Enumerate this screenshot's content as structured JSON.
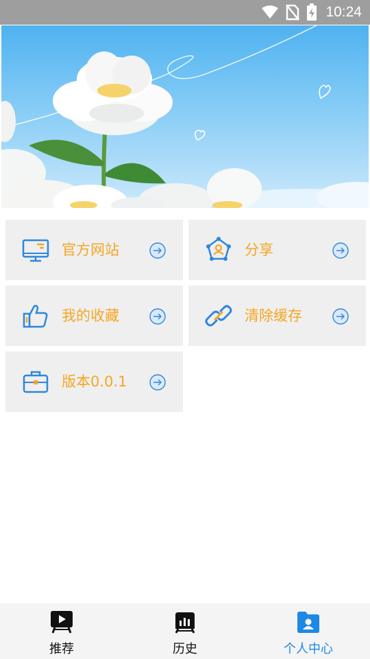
{
  "status_bar": {
    "time": "10:24",
    "icons": [
      "wifi-icon",
      "no-sim-icon",
      "battery-charging-icon"
    ]
  },
  "banner": {
    "description_icon": "flower-banner-image"
  },
  "menu": {
    "items": [
      {
        "label": "官方网站",
        "icon": "monitor-icon"
      },
      {
        "label": "分享",
        "icon": "share-network-icon"
      },
      {
        "label": "我的收藏",
        "icon": "thumbs-up-icon"
      },
      {
        "label": "清除缓存",
        "icon": "link-icon"
      },
      {
        "label": "版本0.0.1",
        "icon": "briefcase-icon"
      }
    ],
    "arrow_icon": "arrow-right-circle-icon"
  },
  "tabbar": {
    "tabs": [
      {
        "label": "推荐",
        "icon": "video-play-icon",
        "active": false
      },
      {
        "label": "历史",
        "icon": "history-icon",
        "active": false
      },
      {
        "label": "个人中心",
        "icon": "user-folder-icon",
        "active": true
      }
    ],
    "active_color": "#1e88e5",
    "label_color": "#111111"
  },
  "colors": {
    "accent_text": "#f5a623",
    "icon_blue": "#2e86de",
    "card_bg": "#efefef"
  }
}
